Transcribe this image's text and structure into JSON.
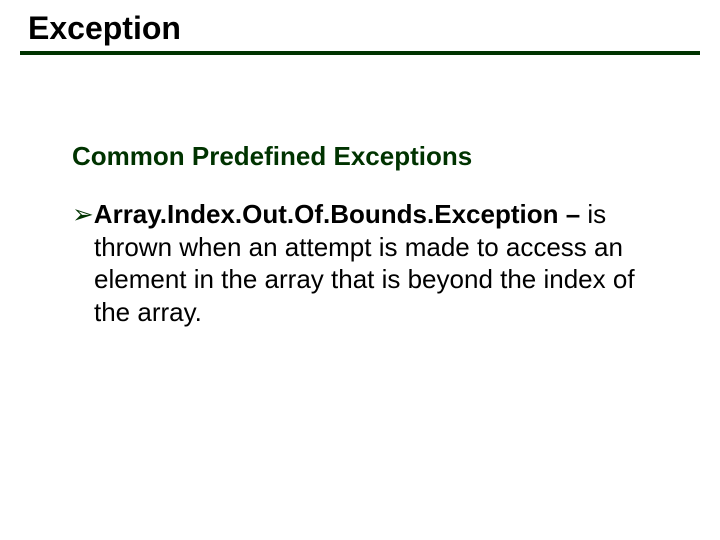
{
  "title": "Exception",
  "subhead": "Common Predefined Exceptions",
  "bullet_glyph": "➢",
  "item": {
    "name": "Array.Index.Out.Of.Bounds.Exception",
    "dash": " – ",
    "desc": "is thrown when an attempt is made to access an element in the array that is beyond the index of the array."
  }
}
